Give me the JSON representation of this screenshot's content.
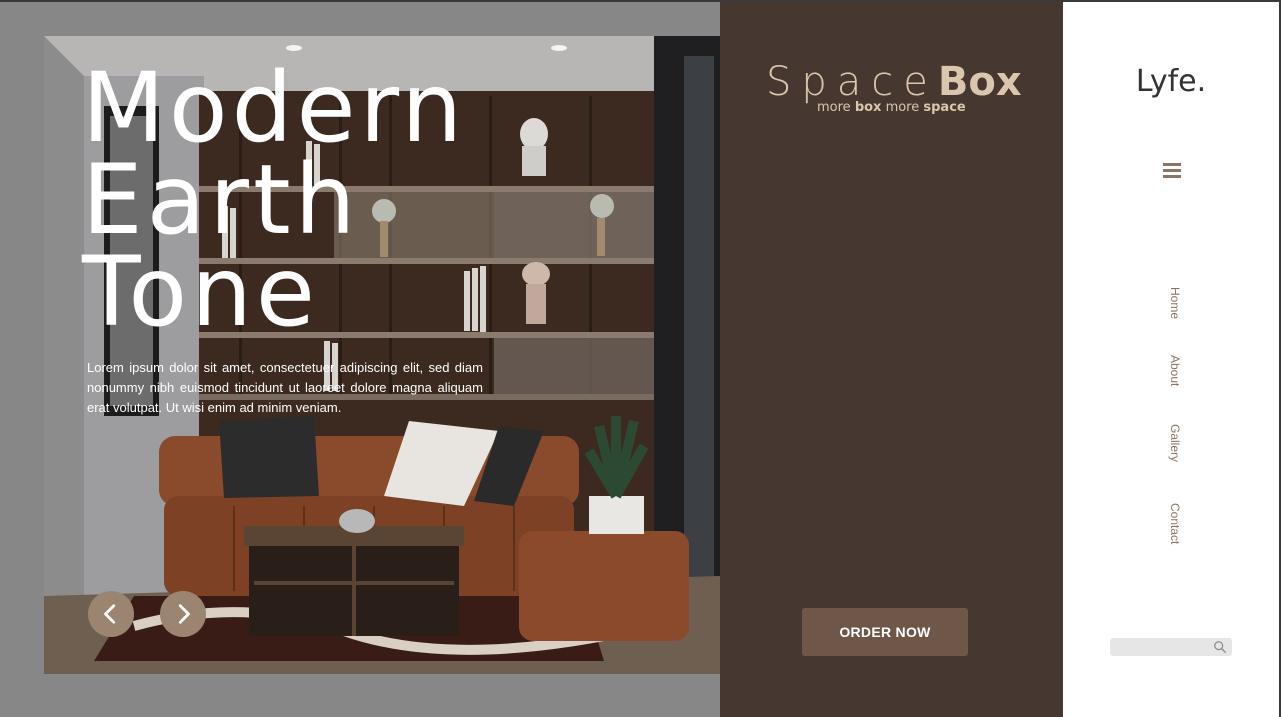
{
  "hero": {
    "title_line1": "Modern",
    "title_line2": "Earth",
    "title_line3": "Tone",
    "text": "Lorem ipsum dolor sit amet, consectetuer adipiscing elit, sed diam nonummy nibh euismod tincidunt ut laoreet dolore magna aliquam erat volutpat. Ut wisi enim ad minim veniam."
  },
  "slider": {
    "prev_icon": "chevron-left-icon",
    "next_icon": "chevron-right-icon"
  },
  "brand": {
    "name_light": "Space",
    "name_bold": "Box",
    "tagline_part1": "more ",
    "tagline_part2": "box",
    "tagline_part3": " more ",
    "tagline_part4": "space"
  },
  "cta": {
    "order_label": "ORDER NOW"
  },
  "sidebar": {
    "logo": "Lyfe.",
    "menu_icon": "hamburger-menu-icon",
    "nav": [
      {
        "label": "Home"
      },
      {
        "label": "About"
      },
      {
        "label": "Gallery"
      },
      {
        "label": "Contact"
      }
    ],
    "search": {
      "placeholder": "",
      "icon": "search-icon"
    }
  },
  "colors": {
    "left_bg": "#878787",
    "mid_panel": "#473731",
    "brand_beige": "#d9c6ac",
    "button_brown": "#6e5649",
    "nav_brown": "#8a7564",
    "arrow_bg": "#9b8570"
  }
}
